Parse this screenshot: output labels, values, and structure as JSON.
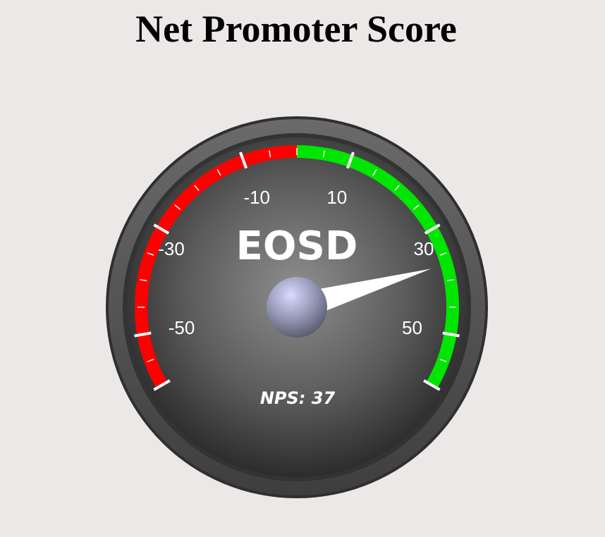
{
  "page": {
    "title": "Net Promoter Score"
  },
  "chart_data": {
    "type": "gauge",
    "gauge_name": "EOSD",
    "value_label": "NPS: 37",
    "value": 37,
    "range": [
      -60,
      60
    ],
    "major_ticks": [
      -50,
      -30,
      -10,
      10,
      30,
      50
    ],
    "tick_labels": [
      "-50",
      "-30",
      "-10",
      "10",
      "30",
      "50"
    ],
    "bands": [
      {
        "from": -60,
        "to": 0,
        "color": "#ff0000"
      },
      {
        "from": 0,
        "to": 60,
        "color": "#00e600"
      }
    ],
    "colors": {
      "bezel_outer": "#4a4a4a",
      "bezel_inner": "#5c5c5c",
      "face_center": "#8a8a8a",
      "face_edge": "#2e2e2e",
      "needle": "#ffffff",
      "hub": "#b9bbd8"
    }
  }
}
